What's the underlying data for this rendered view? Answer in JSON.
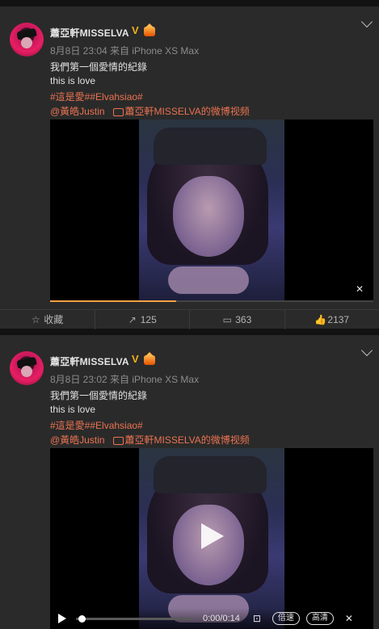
{
  "posts": [
    {
      "user_name": "蕭亞軒MISSELVA",
      "meta": "8月8日 23:04 来自 iPhone XS Max",
      "text1": "我們第一個愛情的紀錄",
      "text2": "this is love",
      "tags": "#這是愛##Elvahsiao#",
      "mention": "@黃皓Justin",
      "video_link": "蕭亞軒MISSELVA的微博视频",
      "video_progress_fraction": 0.39,
      "actions": {
        "favorite": "收藏",
        "repost": "125",
        "comment": "363",
        "like": "2137"
      }
    },
    {
      "user_name": "蕭亞軒MISSELVA",
      "meta": "8月8日 23:02 来自 iPhone XS Max",
      "text1": "我們第一個愛情的紀錄",
      "text2": "this is love",
      "tags": "#這是愛##Elvahsiao#",
      "mention": "@黃皓Justin",
      "video_link": "蕭亞軒MISSELVA的微博视频",
      "player": {
        "time": "0:00/0:14",
        "speed_label": "倍速",
        "quality_label": "高清"
      }
    }
  ],
  "icons": {
    "verified": "V",
    "mute": "mute-icon",
    "favorite": "star-outline-icon",
    "repost": "share-arrow-icon",
    "comment": "comment-bubble-icon",
    "like": "thumbs-up-icon"
  },
  "colors": {
    "background": "#1b1b1b",
    "card": "#2a2a2a",
    "link_orange": "#eb7350",
    "progress_orange": "#f2a144",
    "verified_gold": "#f2b01e"
  }
}
